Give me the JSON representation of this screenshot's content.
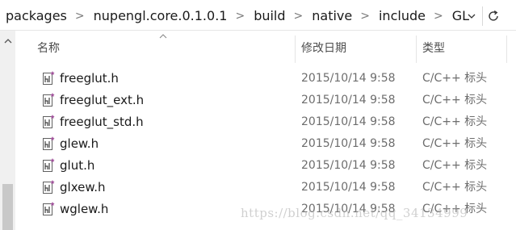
{
  "breadcrumb": {
    "items": [
      "packages",
      "nupengl.core.0.1.0.1",
      "build",
      "native",
      "include",
      "GL"
    ],
    "separator": ">"
  },
  "address_controls": {
    "dropdown_icon": "chevron-down-icon",
    "refresh_icon": "refresh-icon"
  },
  "columns": {
    "name": "名称",
    "modified": "修改日期",
    "type": "类型"
  },
  "files": [
    {
      "name": "freeglut.h",
      "modified": "2015/10/14 9:58",
      "type": "C/C++ 标头"
    },
    {
      "name": "freeglut_ext.h",
      "modified": "2015/10/14 9:58",
      "type": "C/C++ 标头"
    },
    {
      "name": "freeglut_std.h",
      "modified": "2015/10/14 9:58",
      "type": "C/C++ 标头"
    },
    {
      "name": "glew.h",
      "modified": "2015/10/14 9:58",
      "type": "C/C++ 标头"
    },
    {
      "name": "glut.h",
      "modified": "2015/10/14 9:58",
      "type": "C/C++ 标头"
    },
    {
      "name": "glxew.h",
      "modified": "2015/10/14 9:58",
      "type": "C/C++ 标头"
    },
    {
      "name": "wglew.h",
      "modified": "2015/10/14 9:58",
      "type": "C/C++ 标头"
    }
  ],
  "watermark": "https://blog.csdn.net/qq_34134999",
  "colors": {
    "icon_accent": "#a0509a",
    "header_text": "#4d4d4d",
    "meta_text": "#6d6d6d"
  }
}
